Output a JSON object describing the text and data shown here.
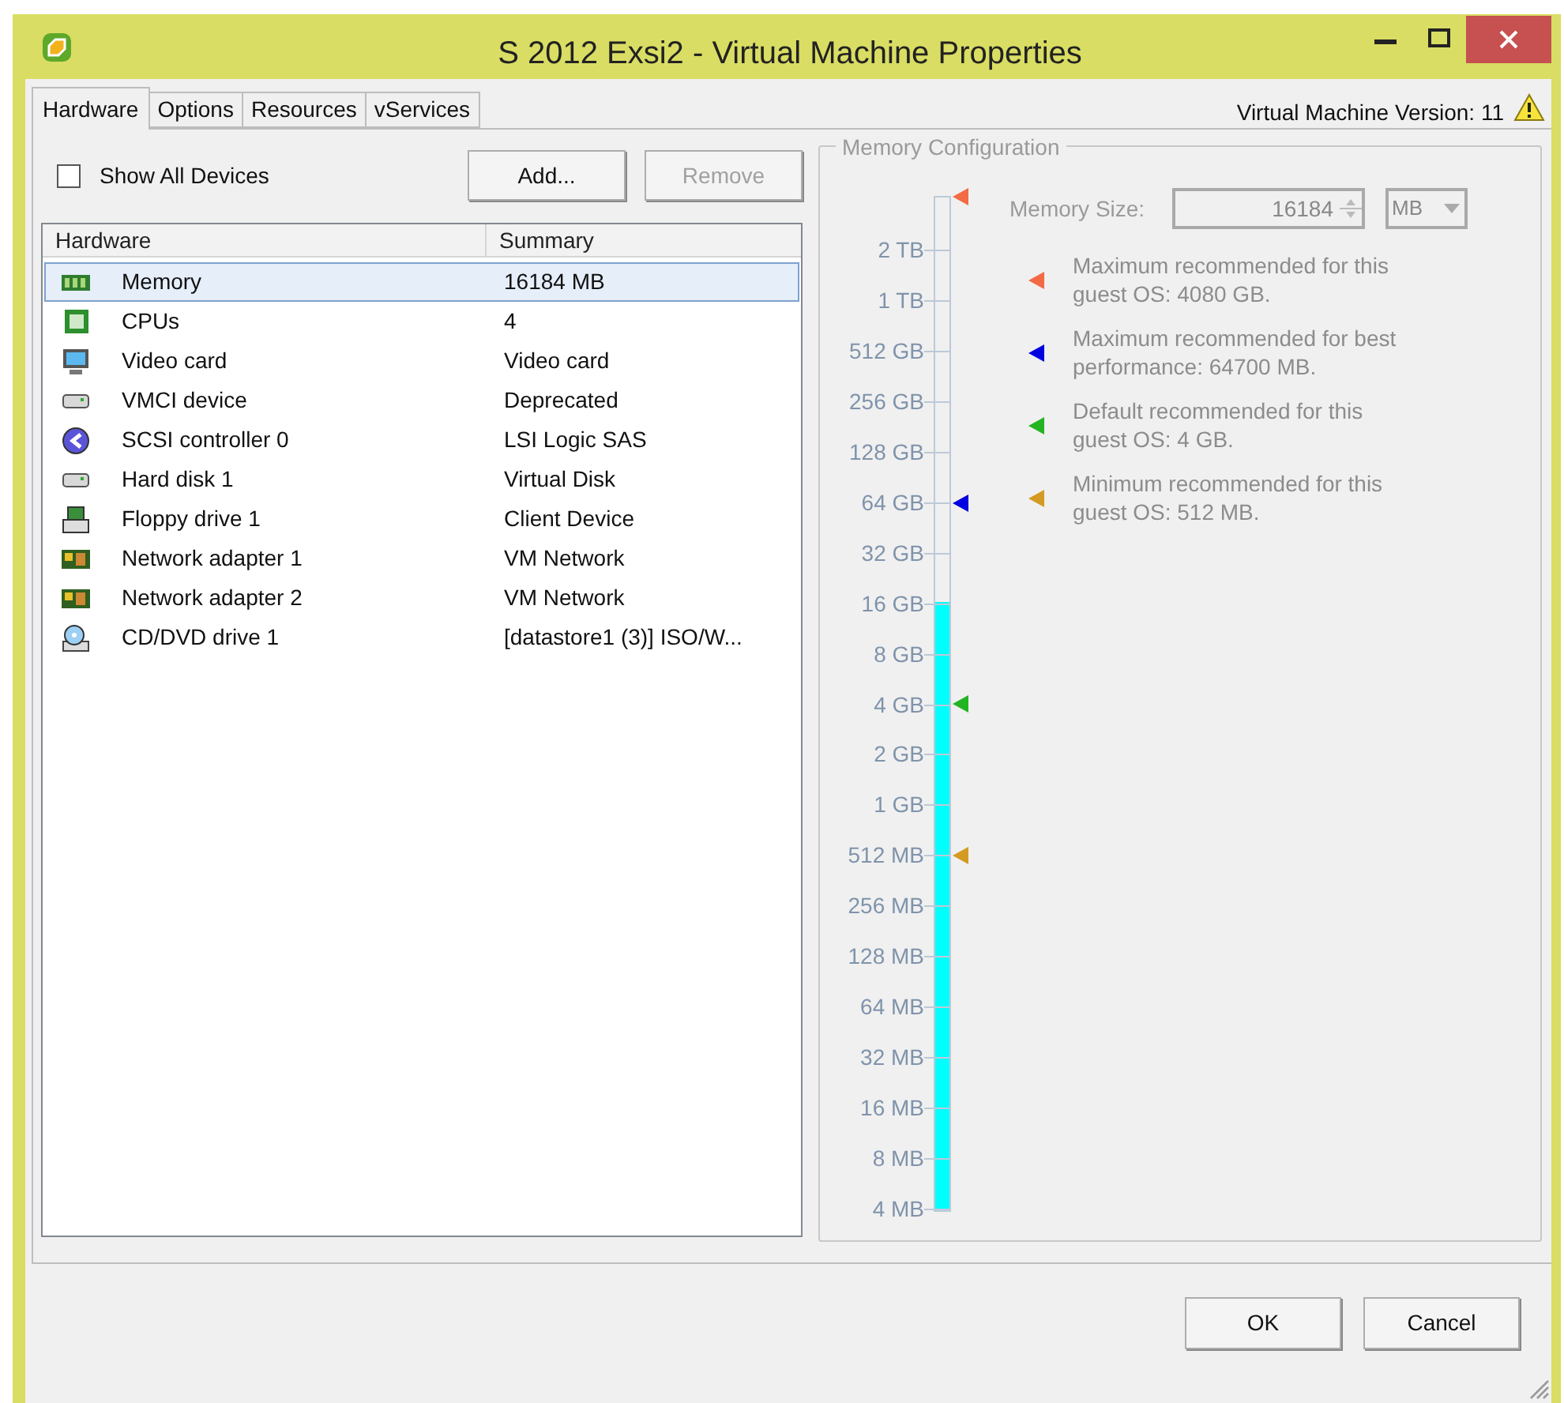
{
  "window": {
    "title": "S 2012 Exsi2 - Virtual Machine Properties"
  },
  "tabs": [
    {
      "label": "Hardware",
      "selected": true
    },
    {
      "label": "Options",
      "selected": false
    },
    {
      "label": "Resources",
      "selected": false
    },
    {
      "label": "vServices",
      "selected": false
    }
  ],
  "version_label": "Virtual Machine Version: 11",
  "show_all_devices": {
    "label": "Show All Devices",
    "checked": false
  },
  "buttons": [
    {
      "label": "Add...",
      "disabled": false
    },
    {
      "label": "Remove",
      "disabled": true
    }
  ],
  "hardware_table": {
    "columns": [
      "Hardware",
      "Summary"
    ],
    "rows": [
      {
        "kind": "memory",
        "name": "Memory",
        "summary": "16184 MB",
        "selected": true
      },
      {
        "kind": "cpu",
        "name": "CPUs",
        "summary": "4",
        "selected": false
      },
      {
        "kind": "video",
        "name": "Video card",
        "summary": "Video card",
        "selected": false
      },
      {
        "kind": "disk",
        "name": "VMCI device",
        "summary": "Deprecated",
        "selected": false
      },
      {
        "kind": "scsi",
        "name": "SCSI controller 0",
        "summary": "LSI Logic SAS",
        "selected": false
      },
      {
        "kind": "disk",
        "name": "Hard disk 1",
        "summary": "Virtual Disk",
        "selected": false
      },
      {
        "kind": "floppy",
        "name": "Floppy drive 1",
        "summary": "Client Device",
        "selected": false
      },
      {
        "kind": "network",
        "name": "Network adapter 1",
        "summary": "VM Network",
        "selected": false
      },
      {
        "kind": "network",
        "name": "Network adapter 2",
        "summary": "VM Network",
        "selected": false
      },
      {
        "kind": "cdrom",
        "name": "CD/DVD drive 1",
        "summary": "[datastore1 (3)] ISO/W...",
        "selected": false
      }
    ]
  },
  "memory_configuration": {
    "title": "Memory Configuration",
    "size_label": "Memory Size:",
    "size_value": "16184",
    "unit": "MB",
    "scale": [
      "2 TB",
      "1 TB",
      "512 GB",
      "256 GB",
      "128 GB",
      "64 GB",
      "32 GB",
      "16 GB",
      "8 GB",
      "4 GB",
      "2 GB",
      "1 GB",
      "512 MB",
      "256 MB",
      "128 MB",
      "64 MB",
      "32 MB",
      "16 MB",
      "8 MB",
      "4 MB"
    ],
    "level": 0.6,
    "markers": [
      {
        "color": "#f26b45",
        "level": 1.0
      },
      {
        "color": "#0000e0",
        "level": 0.697
      },
      {
        "color": "#22b422",
        "level": 0.5
      },
      {
        "color": "#d49a22",
        "level": 0.35
      }
    ],
    "recommendations": [
      {
        "text": "Maximum recommended for this guest OS: 4080 GB.",
        "color": "#f26b45"
      },
      {
        "text": "Maximum recommended for best performance: 64700 MB.",
        "color": "#0000e0"
      },
      {
        "text": "Default recommended for this guest OS: 4 GB.",
        "color": "#22b422"
      },
      {
        "text": "Minimum recommended for this guest OS: 512 MB.",
        "color": "#d49a22"
      }
    ]
  },
  "footer_buttons": [
    "OK",
    "Cancel"
  ]
}
